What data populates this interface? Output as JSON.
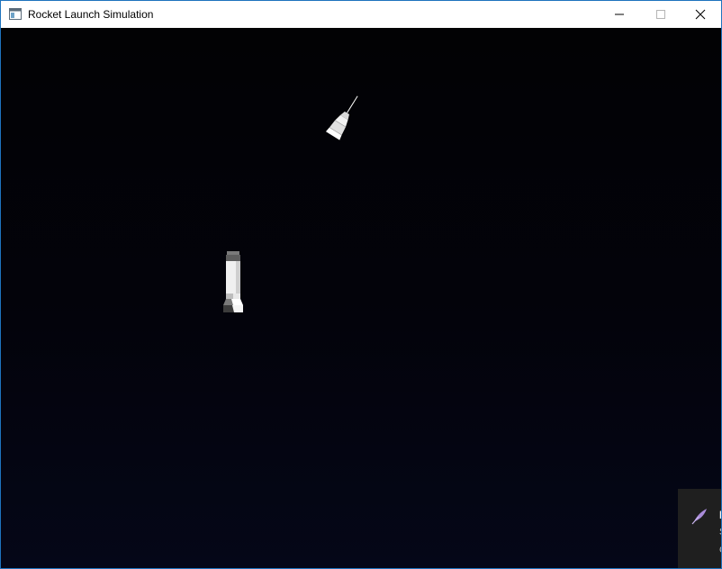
{
  "window": {
    "title": "Rocket Launch Simulation",
    "icon": "window-app-icon",
    "controls": [
      "minimize-icon",
      "maximize-icon",
      "close-icon"
    ]
  },
  "scene": {
    "background_top": "#020204",
    "background_bottom": "#050718",
    "objects": [
      "rocket-upper-stage",
      "rocket-booster-stage"
    ]
  },
  "notification": {
    "icon": "feather-icon",
    "title": "I",
    "line1": "S",
    "line2": "C"
  }
}
